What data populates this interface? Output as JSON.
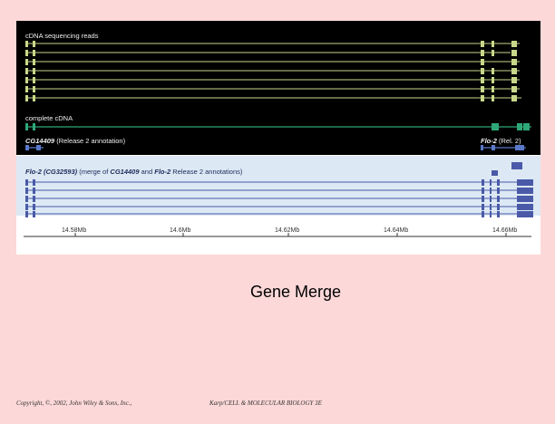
{
  "figure": {
    "sections": {
      "reads_label": "cDNA sequencing reads",
      "complete_label": "complete cDNA",
      "cg_label_gene": "CG14409",
      "cg_label_rest": "(Release 2 annotation)",
      "flo_label_gene": "Flo-2",
      "flo_label_rest": "(Rel. 2)",
      "merge_label": {
        "gene": "Flo-2",
        "id": "(CG32593)",
        "text1": "(merge of",
        "gene2": "CG14409",
        "text2": "and",
        "gene3": "Flo-2",
        "text3": "Release 2 annotations)"
      }
    },
    "axis_ticks": [
      "14.58Mb",
      "14.6Mb",
      "14.62Mb",
      "14.64Mb",
      "14.66Mb"
    ],
    "colors": {
      "dark_panel": "#000000",
      "light_panel": "#dce8f4",
      "read_track": "#c8d88a",
      "complete_track": "#2fa878",
      "annotation_track": "#5a78c8",
      "merge_track": "#4a5aa8"
    }
  },
  "caption": "Gene Merge",
  "footer": {
    "copyright": "Copyright, ©, 2002, John Wiley & Sons, Inc.,",
    "source": "Karp/CELL & MOLECULAR BIOLOGY 3E"
  }
}
